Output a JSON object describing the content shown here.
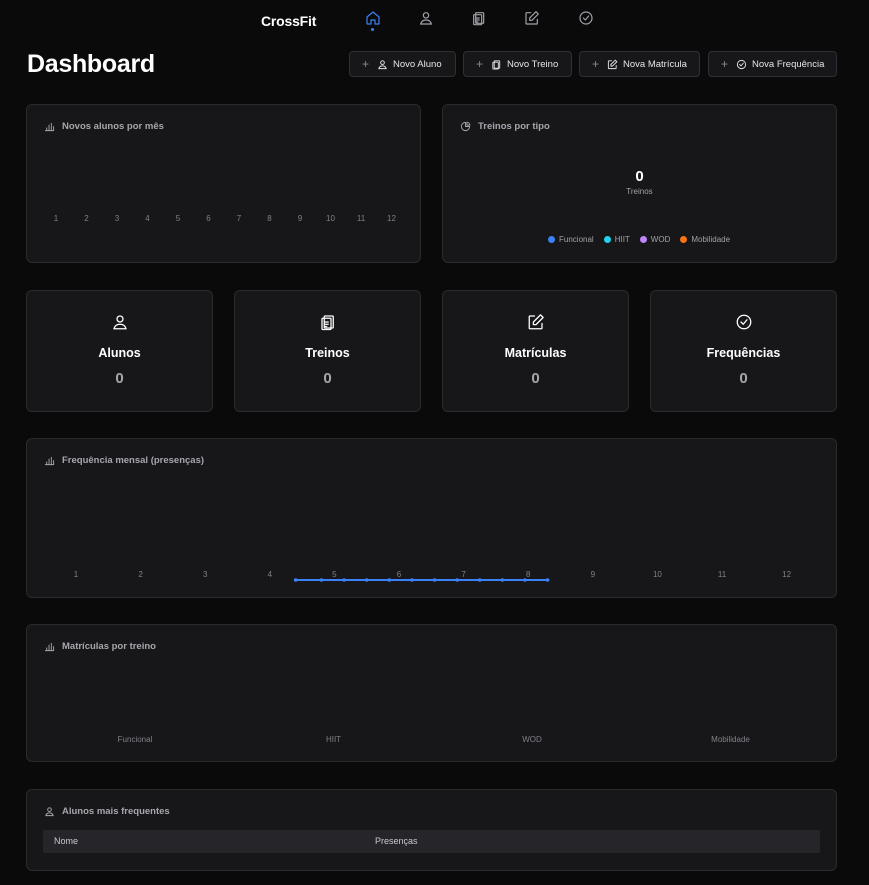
{
  "brand": "CrossFit",
  "nav": {
    "items": [
      {
        "name": "home",
        "icon": "home-icon",
        "active": true
      },
      {
        "name": "alunos",
        "icon": "user-icon"
      },
      {
        "name": "treinos",
        "icon": "clipboard-icon"
      },
      {
        "name": "matriculas",
        "icon": "edit-icon"
      },
      {
        "name": "frequencias",
        "icon": "check-circle-icon"
      }
    ]
  },
  "page_title": "Dashboard",
  "actions": {
    "novo_aluno": "Novo Aluno",
    "novo_treino": "Novo Treino",
    "nova_matricula": "Nova Matrícula",
    "nova_frequencia": "Nova Frequência"
  },
  "colors": {
    "accent": "#3b82f6",
    "funcional": "#3b82f6",
    "hiit": "#22d3ee",
    "wod": "#c084fc",
    "mobilidade": "#f97316"
  },
  "novos_alunos": {
    "title": "Novos alunos por mês"
  },
  "treinos_tipo": {
    "title": "Treinos por tipo",
    "total": "0",
    "total_label": "Treinos"
  },
  "stats": {
    "alunos": {
      "label": "Alunos",
      "value": "0"
    },
    "treinos": {
      "label": "Treinos",
      "value": "0"
    },
    "matriculas": {
      "label": "Matrículas",
      "value": "0"
    },
    "frequencias": {
      "label": "Frequências",
      "value": "0"
    }
  },
  "frequencia_mensal": {
    "title": "Frequência mensal (presenças)"
  },
  "matriculas_treino": {
    "title": "Matrículas por treino"
  },
  "frequentes": {
    "title": "Alunos mais frequentes",
    "columns": {
      "nome": "Nome",
      "presencas": "Presenças"
    }
  },
  "chart_data": [
    {
      "type": "bar",
      "title": "Novos alunos por mês",
      "categories": [
        "1",
        "2",
        "3",
        "4",
        "5",
        "6",
        "7",
        "8",
        "9",
        "10",
        "11",
        "12"
      ],
      "values": [
        0,
        0,
        0,
        0,
        0,
        0,
        0,
        0,
        0,
        0,
        0,
        0
      ]
    },
    {
      "type": "pie",
      "title": "Treinos por tipo",
      "categories": [
        "Funcional",
        "HIIT",
        "WOD",
        "Mobilidade"
      ],
      "values": [
        0,
        0,
        0,
        0
      ]
    },
    {
      "type": "line",
      "title": "Frequência mensal (presenças)",
      "x": [
        "1",
        "2",
        "3",
        "4",
        "5",
        "6",
        "7",
        "8",
        "9",
        "10",
        "11",
        "12"
      ],
      "marker_x": [
        4.4,
        4.8,
        5.15,
        5.5,
        5.85,
        6.2,
        6.55,
        6.9,
        7.25,
        7.6,
        7.95,
        8.3
      ],
      "values": [
        0,
        0,
        0,
        0,
        0,
        0,
        0,
        0,
        0,
        0,
        0,
        0
      ]
    },
    {
      "type": "bar",
      "title": "Matrículas por treino",
      "categories": [
        "Funcional",
        "HIIT",
        "WOD",
        "Mobilidade"
      ],
      "values": [
        0,
        0,
        0,
        0
      ]
    }
  ]
}
